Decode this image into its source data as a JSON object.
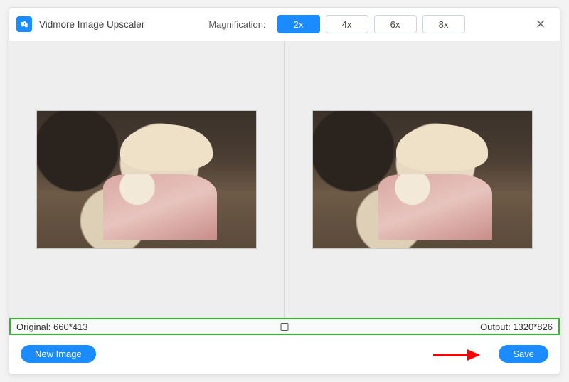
{
  "app": {
    "title": "Vidmore Image Upscaler",
    "logo_icon": "puzzle-icon"
  },
  "header": {
    "magnification_label": "Magnification:",
    "mag_options": [
      "2x",
      "4x",
      "6x",
      "8x"
    ],
    "mag_selected": "2x",
    "close_glyph": "×"
  },
  "info": {
    "original_label": "Original:",
    "original_value": "660*413",
    "output_label": "Output:",
    "output_value": "1320*826"
  },
  "footer": {
    "new_image_label": "New Image",
    "save_label": "Save"
  },
  "colors": {
    "accent": "#1b8cff",
    "highlight_border": "#2dbb2d",
    "annotation_arrow": "#ff0000"
  }
}
